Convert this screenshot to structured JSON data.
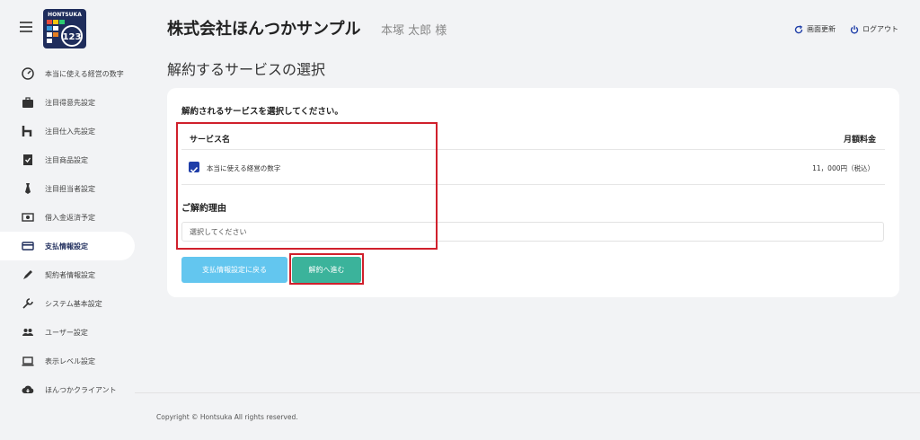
{
  "header": {
    "company": "株式会社ほんつかサンプル",
    "user": "本塚 太郎 様",
    "refresh_label": "画面更新",
    "logout_label": "ログアウト"
  },
  "logo": {
    "brand": "HONTSUKA",
    "number": "123"
  },
  "sidebar": {
    "items": [
      {
        "label": "本当に使える経営の数字",
        "icon": "dashboard-gauge-icon"
      },
      {
        "label": "注目得意先設定",
        "icon": "briefcase-icon"
      },
      {
        "label": "注目仕入先設定",
        "icon": "hotel-h-icon"
      },
      {
        "label": "注目商品設定",
        "icon": "checklist-icon"
      },
      {
        "label": "注目担当者設定",
        "icon": "tie-icon"
      },
      {
        "label": "借入金返済予定",
        "icon": "money-icon"
      },
      {
        "label": "支払情報設定",
        "icon": "credit-card-icon",
        "active": true
      },
      {
        "label": "契約者情報設定",
        "icon": "pen-icon"
      },
      {
        "label": "システム基本設定",
        "icon": "wrench-icon"
      },
      {
        "label": "ユーザー設定",
        "icon": "users-icon"
      },
      {
        "label": "表示レベル設定",
        "icon": "laptop-icon"
      },
      {
        "label": "ほんつかクライアント",
        "icon": "cloud-download-icon"
      }
    ]
  },
  "main": {
    "title": "解約するサービスの選択",
    "prompt": "解約されるサービスを選択してください。",
    "table": {
      "col_service": "サービス名",
      "col_price": "月額料金",
      "rows": [
        {
          "name": "本当に使える経営の数字",
          "price": "11，000円（税込）",
          "checked": true
        }
      ]
    },
    "reason_title": "ご解約理由",
    "reason_placeholder": "選択してください",
    "back_button": "支払情報設定に戻る",
    "next_button": "解約へ進む"
  },
  "footer": {
    "copyright": "Copyright © Hontsuka All rights reserved."
  },
  "colors": {
    "primary": "#1f3ea8",
    "back_button": "#63c6ef",
    "next_button": "#3bb39b",
    "highlight": "#d0202c"
  }
}
